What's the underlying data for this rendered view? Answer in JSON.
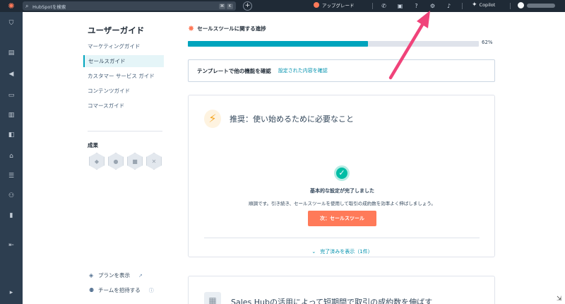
{
  "topbar": {
    "search_placeholder": "HubSpotを検索",
    "kbd_1": "⌘",
    "kbd_2": "K",
    "upgrade_label": "アップグレード",
    "copilot_label": "Copilot"
  },
  "guide": {
    "title": "ユーザーガイド",
    "items": [
      {
        "label": "マーケティングガイド"
      },
      {
        "label": "セールスガイド"
      },
      {
        "label": "カスタマー サービス ガイド"
      },
      {
        "label": "コンテンツガイド"
      },
      {
        "label": "コマースガイド"
      }
    ],
    "achievements_title": "成果",
    "view_plan_label": "プランを表示",
    "invite_team_label": "チームを招待する"
  },
  "progress": {
    "title": "セールスツールに関する進捗",
    "percent_label": "62%",
    "value": 0.62
  },
  "template_box": {
    "text": "テンプレートで他の機能を確認",
    "link": "設定された内容を確認"
  },
  "card": {
    "title": "推奨：使い始めるために必要なこと",
    "done_title": "基本的な設定が完了しました",
    "done_desc": "順調です。引き続き、セールスツールを使用して取引の成約数を効率よく伸ばしましょう。",
    "next_button": "次：セールスツール",
    "show_done": "完了済みを表示（1件）"
  },
  "card2": {
    "title": "Sales Hubの活用によって短期間で取引の成約数を伸ばす"
  },
  "colors": {
    "accent": "#00a4bd",
    "cta": "#ff7a59",
    "arrow": "#f0437a",
    "topbar": "#1f2a36"
  }
}
